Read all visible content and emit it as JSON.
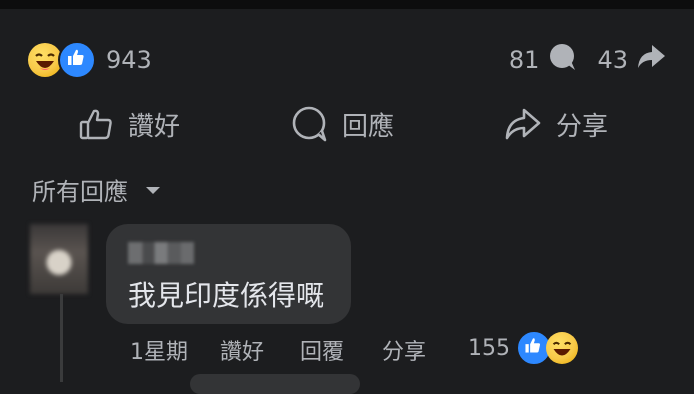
{
  "reactions": {
    "count": "943"
  },
  "stats": {
    "comments": "81",
    "shares": "43"
  },
  "actions": {
    "like": "讚好",
    "comment": "回應",
    "share": "分享"
  },
  "filter": {
    "label": "所有回應"
  },
  "comment": {
    "text": "我見印度係得嘅",
    "time": "1星期",
    "like": "讚好",
    "reply": "回覆",
    "share": "分享",
    "reaction_count": "155"
  }
}
